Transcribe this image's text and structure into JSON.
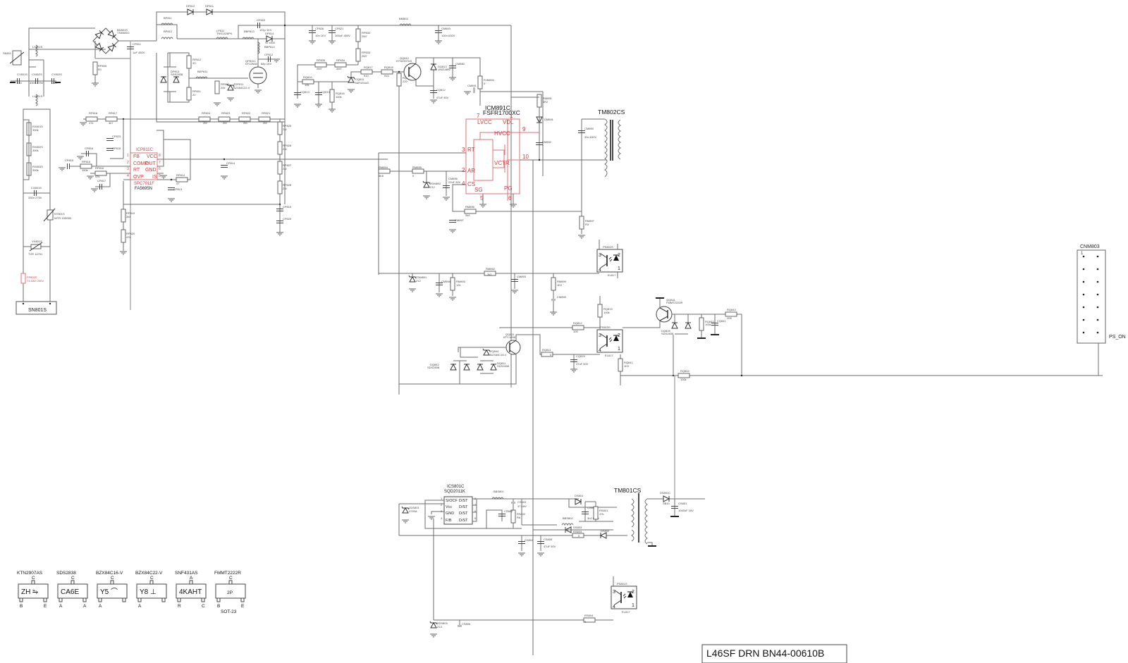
{
  "title_block": "L46SF DRN BN44-00610B",
  "input_section": {
    "connector": "SN801S",
    "fuse": {
      "ref": "FP801S",
      "value": "T4.0AH 250V"
    },
    "surge": {
      "ref": "SA801"
    },
    "line_filter_1": {
      "ref": "LX802S"
    },
    "line_filter_2": {
      "ref": "LX801S"
    },
    "caps": [
      {
        "ref": "CY801S",
        "value": "220"
      },
      {
        "ref": "CX802S",
        "value": "330n 275V"
      },
      {
        "ref": "CY802S",
        "value": "220"
      },
      {
        "ref": "CX801S",
        "value": "330n 275V"
      }
    ],
    "bleeder": [
      {
        "ref": "RX801S",
        "value": "390k"
      },
      {
        "ref": "RX802S",
        "value": "390k"
      },
      {
        "ref": "RX803S",
        "value": "390k"
      }
    ],
    "ntc": {
      "ref": "NT801S",
      "value": "WTR 15D050"
    },
    "varistor": {
      "ref": "VX801S",
      "value": "TVR 14751"
    },
    "bridge": {
      "ref": "BD801S",
      "value": "TS4B05G"
    },
    "cp811": {
      "ref": "CP811",
      "value": "1uF 450V"
    },
    "rp809": {
      "ref": "RP809",
      "value": "R1"
    }
  },
  "pfc_section": {
    "diodes_top": [
      "DP812",
      "DP811"
    ],
    "bead_1": "BP811",
    "bead_2": "BP812",
    "inductor": {
      "ref": "LP811",
      "value": "TNS1326PK"
    },
    "bead_3": "BBP813",
    "bead_4": "BBP814",
    "diode": {
      "ref": "DP814",
      "value": "ST1000"
    },
    "cap_top": {
      "ref": "CP820",
      "value": "101p 1KV"
    },
    "cap_snub": {
      "ref": "CP812",
      "value": "68p 1KV"
    },
    "mosfet": {
      "ref": "QP811C",
      "value": "KF12N60"
    },
    "dual_diode": {
      "ref": "DP813",
      "value": "SDS2838"
    },
    "rp812": {
      "ref": "RP812",
      "value": "33"
    },
    "rp811": {
      "ref": "RP811",
      "value": "22"
    },
    "bead_gate": "BEP811",
    "rp813": {
      "ref": "RP813",
      "value": "20k"
    },
    "zener": {
      "ref": "ZDP811",
      "value": "BZX84C22-V"
    },
    "divider": [
      {
        "ref": "RP818",
        "value": "47k"
      },
      {
        "ref": "RP817",
        "value": "4k7"
      },
      {
        "ref": "RP824",
        "value": "2M"
      },
      {
        "ref": "RP823",
        "value": "2M"
      },
      {
        "ref": "RP822",
        "value": "2M"
      },
      {
        "ref": "RP821",
        "value": "2M"
      }
    ],
    "ovp_chain": [
      {
        "ref": "RP825",
        "value": "2M"
      },
      {
        "ref": "RP826",
        "value": "2M"
      },
      {
        "ref": "RP827",
        "value": "2M"
      },
      {
        "ref": "RP828",
        "value": "2M"
      }
    ],
    "cp819": "CP819",
    "cp820b": "CP820",
    "rp819": {
      "ref": "RP819",
      "value": "2k4"
    },
    "rp820": {
      "ref": "RP820",
      "value": "47k"
    },
    "cp823": "CP823",
    "cp818": "CP818",
    "cp816": "CP816",
    "cp815": "CP815",
    "cp817": "CP817",
    "rp815": {
      "ref": "RP815",
      "value": "150k"
    },
    "rp816": {
      "ref": "RP816",
      "value": "47k"
    },
    "rp814": {
      "ref": "RP814",
      "value": "47"
    },
    "cp813": "CP813",
    "cp814": "CP814",
    "ic": {
      "ref": "ICP811C",
      "part_red": "SPC7011F",
      "part": "FA5695N",
      "pins_left": [
        {
          "num": "1",
          "name": "FB"
        },
        {
          "num": "2",
          "name": "COMP"
        },
        {
          "num": "3",
          "name": "RT"
        },
        {
          "num": "4",
          "name": "OVP"
        }
      ],
      "pins_right": [
        {
          "num": "8",
          "name": "VCC"
        },
        {
          "num": "7",
          "name": "OUT"
        },
        {
          "num": "6",
          "name": "GND"
        },
        {
          "num": "5",
          "name": "IS"
        }
      ]
    }
  },
  "llc_section": {
    "bead": "BM803",
    "cp826": {
      "ref": "CP826",
      "value": "10n 1KV"
    },
    "cp821": {
      "ref": "CP821",
      "value": "100uF 450V"
    },
    "cm800": {
      "ref": "CM800",
      "value": "100n 630V"
    },
    "rp832": {
      "ref": "RP832",
      "value": "2M7"
    },
    "rp833": {
      "ref": "RP833",
      "value": "2M7"
    },
    "rp835": {
      "ref": "RP835",
      "value": "2M7"
    },
    "rp834": {
      "ref": "RP834",
      "value": "2M7"
    },
    "rq810": {
      "ref": "RQ810",
      "value": "10k"
    },
    "cq813": "CQ813",
    "cq810": "CQ810",
    "rq816": {
      "ref": "RQ816",
      "value": "100k"
    },
    "shunt": {
      "ref": "ICQ811",
      "value": "SNF431AS"
    },
    "rq817": {
      "ref": "RQ817",
      "value": "910"
    },
    "rq818": {
      "ref": "RQ818",
      "value": "910"
    },
    "rq814": {
      "ref": "RQ814",
      "value": "220"
    },
    "transistor": {
      "ref": "QQ812",
      "value": "KTN2907AS"
    },
    "dq813": {
      "ref": "DQ813",
      "value": "1N4148W"
    },
    "cq812": {
      "ref": "CQ812",
      "value": "47uF 50V"
    },
    "cm880": "CM880",
    "rm894": {
      "ref": "RJM894",
      "value": "0"
    },
    "cm891": "CM891",
    "rm891": {
      "ref": "RM891",
      "value": "6R2"
    },
    "dm891": "DM891",
    "cm892": "CM892",
    "cm890": {
      "ref": "CM890",
      "value": "33n 630V"
    },
    "transformer": "TM802CS",
    "ic": {
      "ref": "ICM891C",
      "part": "FSFR1700XC",
      "pins": [
        {
          "num": "7",
          "name": "LVCC"
        },
        {
          "num": "1",
          "name": "VDL"
        },
        {
          "num": "9",
          "name": "HVCC"
        },
        {
          "num": "3",
          "name": "RT"
        },
        {
          "num": "10",
          "name": "VCTR"
        },
        {
          "num": "2",
          "name": "AR"
        },
        {
          "num": "4",
          "name": "CS"
        },
        {
          "num": "5",
          "name": "SG"
        },
        {
          "num": "6",
          "name": "PG"
        }
      ]
    },
    "rm894b": {
      "ref": "RM894",
      "value": "5K6"
    },
    "rm895": {
      "ref": "RM895",
      "value": "0"
    },
    "zdm892": {
      "ref": "ZDM892",
      "value": "Z12"
    },
    "cm896": {
      "ref": "CM896",
      "value": "22uF 50V"
    },
    "rm896": {
      "ref": "RM896",
      "value": "2k4"
    },
    "cm897": "CM897",
    "rm897": {
      "ref": "RM897",
      "value": "R3"
    }
  },
  "feedback_section": {
    "zdm891": {
      "ref": "ZDM891",
      "value": "Z12"
    },
    "cm894": "CM894",
    "rm893": {
      "ref": "RM893",
      "value": "12k"
    },
    "rm892": {
      "ref": "RM892",
      "value": "2k2"
    },
    "cm893": "CM893",
    "rm899": {
      "ref": "RM899",
      "value": "1K2"
    },
    "cm899": "CM899",
    "opto1": {
      "ref": "PS802S",
      "value": "EL817"
    },
    "opto2": {
      "ref": "PS803S",
      "value": "EL817"
    },
    "opto3": {
      "ref": "PS801S",
      "value": "EL817"
    },
    "rq813": {
      "ref": "RQ813",
      "value": "100k"
    },
    "rq812": {
      "ref": "RQ812",
      "value": "100"
    },
    "qq811": {
      "ref": "QQ811",
      "value": "KTC1008"
    },
    "zq844": {
      "ref": "ZQ844",
      "value": "BZX84C16-V"
    },
    "dq842": {
      "ref": "DQ842",
      "value": "SDS2838"
    },
    "dq811": {
      "ref": "DQ811",
      "value": "SDS2838"
    },
    "rq811": {
      "ref": "RQ811",
      "value": "0"
    },
    "cq815": {
      "ref": "CQ815",
      "value": "47uF 50V"
    },
    "rq841": {
      "ref": "RQ841",
      "value": "1K0"
    },
    "rq844": {
      "ref": "RQ844",
      "value": "100k"
    },
    "qq841": {
      "ref": "QQ841",
      "value": "FMMT2222R"
    },
    "dq826": {
      "ref": "DQ826",
      "value": "SDS2838"
    },
    "rq842": {
      "ref": "RQ842",
      "value": "100k"
    },
    "cq841": "CQ841",
    "rq843": {
      "ref": "RQ843",
      "value": "20K"
    }
  },
  "connector": {
    "ref": "CNM803",
    "pin1": "1",
    "signal": "PS_ON"
  },
  "standby_section": {
    "ic": {
      "ref": "ICS801C",
      "part": "SQD2011K",
      "pins_left": [
        {
          "num": "1",
          "name": "S/OCF"
        },
        {
          "num": "2",
          "name": "Vcc"
        },
        {
          "num": "3",
          "name": "GND"
        },
        {
          "num": "4",
          "name": "F/B"
        }
      ],
      "pins_right": [
        {
          "num": "8",
          "name": "D/ST"
        },
        {
          "num": "7",
          "name": "D/ST"
        },
        {
          "num": "6",
          "name": "D/ST"
        },
        {
          "num": "5",
          "name": "D/ST"
        }
      ]
    },
    "zds801": {
      "ref": "ZDS801",
      "value": "4753A"
    },
    "bbs801": "BBS801",
    "cs803": {
      "ref": "CS803",
      "value": "47 16V"
    },
    "cs802": "CS802",
    "rs802": {
      "ref": "RS802",
      "value": "R8"
    },
    "ds801": "DS801",
    "cs801": {
      "ref": "CS801",
      "value": "3n2 630V"
    },
    "rs801": {
      "ref": "RS801",
      "value": "47k"
    },
    "bbs802": "BBS802",
    "ds803": "DS803",
    "rs803": {
      "ref": "RS803",
      "value": "0"
    },
    "ds802": "DS802",
    "cs804": "CS804",
    "cs805": {
      "ref": "CS805",
      "value": "47uF 50V"
    },
    "transformer": "TM801CS",
    "ds851": {
      "ref": "DS851C",
      "value": "SB10"
    },
    "cs851": {
      "ref": "CS851",
      "value": "1000uF 16V"
    },
    "zds803": {
      "ref": "ZDS803",
      "value": "Z13"
    },
    "cs806": "CS806",
    "rs804": {
      "ref": "RS804",
      "value": "0"
    }
  },
  "packages": {
    "footer": "SOT-23",
    "items": [
      {
        "part": "KTN2907AS",
        "mark": "ZH ⥱",
        "top": "C",
        "bl": "B",
        "br": "E"
      },
      {
        "part": "SDS2838",
        "mark": "CA6E",
        "top": "C",
        "bl": "A",
        "br": "A"
      },
      {
        "part": "BZX84C16-V",
        "mark": "Y5  ⌒",
        "top": "C",
        "bl": "A",
        "br": ""
      },
      {
        "part": "BZX84C22-V",
        "mark": "Y8 ⊥",
        "top": "C",
        "bl": "A",
        "br": ""
      },
      {
        "part": "SNF431AS",
        "mark": "4KAHT",
        "top": "A",
        "bl": "R",
        "br": "C"
      },
      {
        "part": "FMMT2222R",
        "mark": "2P",
        "top": "C",
        "bl": "B",
        "br": "E"
      }
    ]
  }
}
